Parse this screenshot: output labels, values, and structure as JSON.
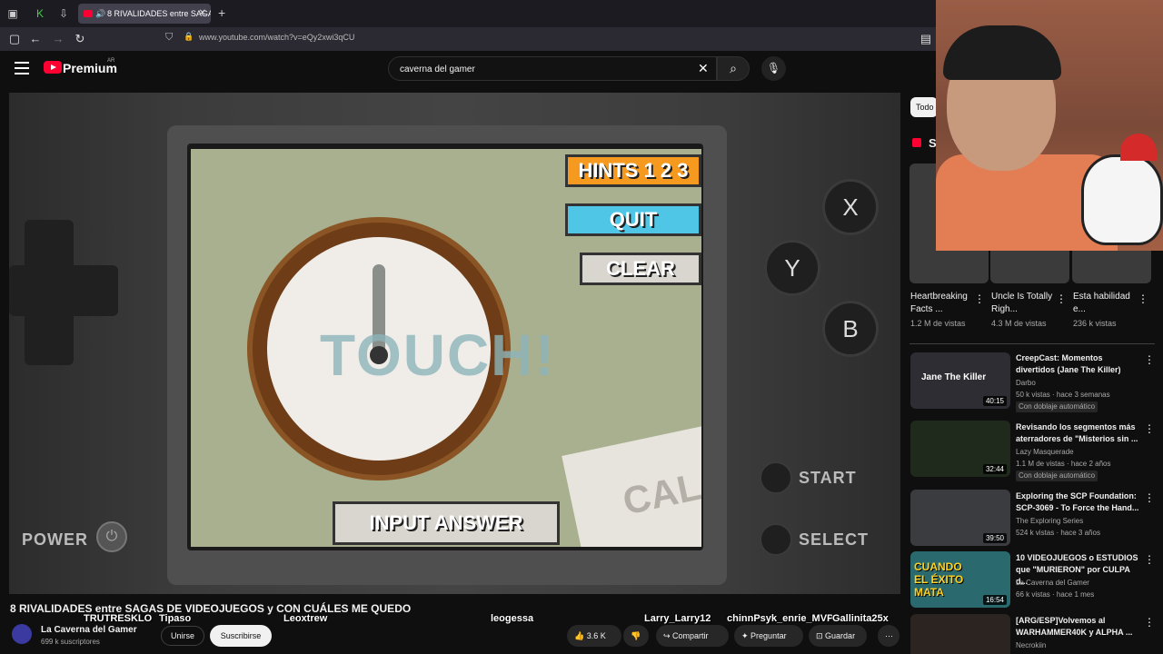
{
  "browser": {
    "tab_title": "8 RIVALIDADES entre SAGAS",
    "url": "www.youtube.com/watch?v=eQy2xwi3qCU"
  },
  "header": {
    "brand": "Premium",
    "region": "AR",
    "search_value": "caverna del gamer"
  },
  "game": {
    "hints_label": "HINTS 1 2 3",
    "quit_label": "QUIT",
    "clear_label": "CLEAR",
    "touch_label": "TOUCH!",
    "input_label": "INPUT ANSWER",
    "paper_label": "CAL",
    "btn_x": "X",
    "btn_y": "Y",
    "btn_b": "B",
    "start_label": "START",
    "select_label": "SELECT",
    "power_label": "POWER"
  },
  "video": {
    "title": "8 RIVALIDADES entre SAGAS DE VIDEOJUEGOS y CON CUÁLES ME QUEDO",
    "channel": "La Caverna del Gamer",
    "subscribers": "699 k suscriptores",
    "join_label": "Unirse",
    "subscribe_label": "Suscribirse",
    "likes": "3.6 K",
    "share_label": "Compartir",
    "ask_label": "Preguntar",
    "save_label": "Guardar"
  },
  "overlay_names": [
    "TRUTRESKLO",
    "Tipaso",
    "Leoxtrew",
    "leogessa",
    "Larry_Larry12",
    "chinnPsyk_enrie_MVP",
    "Gallinita25x"
  ],
  "sidebar": {
    "chip_label": "Todo",
    "shorts_label": "S",
    "shorts": [
      {
        "title": "Heartbreaking Facts ...",
        "views": "1.2 M de vistas"
      },
      {
        "title": "Uncle Is Totally Righ...",
        "views": "4.3 M de vistas"
      },
      {
        "title": "Esta habilidad e...",
        "views": "236 k vistas"
      }
    ],
    "recommendations": [
      {
        "title": "CreepCast: Momentos divertidos (Jane The Killer)",
        "channel": "Darbo",
        "meta": "50 k vistas · hace 3 semanas",
        "duration": "40:15",
        "dub": "Con doblaje automático",
        "thumb_text": "Jane The Killer"
      },
      {
        "title": "Revisando los segmentos más aterradores de \"Misterios sin ...",
        "channel": "Lazy Masquerade",
        "meta": "1.1 M de vistas · hace 2 años",
        "duration": "32:44",
        "dub": "Con doblaje automático",
        "thumb_text": ""
      },
      {
        "title": "Exploring the SCP Foundation: SCP-3069 - To Force the Hand...",
        "channel": "The Exploring Series",
        "meta": "524 k vistas · hace 3 años",
        "duration": "39:50",
        "dub": "",
        "thumb_text": ""
      },
      {
        "title": "10 VIDEOJUEGOS o ESTUDIOS que \"MURIERON\" por CULPA d...",
        "channel": "La Caverna del Gamer",
        "meta": "66 k vistas · hace 1 mes",
        "duration": "16:54",
        "dub": "",
        "thumb_text": "CUANDO EL ÉXITO MATA"
      },
      {
        "title": "[ARG/ESP]Volvemos al WARHAMMER40K y ALPHA ...",
        "channel": "Necrokiin",
        "meta": "",
        "duration": "",
        "dub": "",
        "thumb_text": ""
      }
    ]
  },
  "colors": {
    "yt_red": "#ff0033",
    "accent_orange": "#f59a1e",
    "accent_blue": "#4fc6e6"
  }
}
